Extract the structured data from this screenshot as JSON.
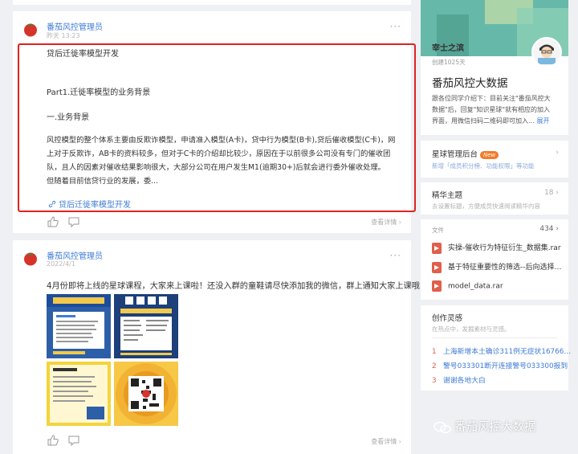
{
  "posts": [
    {
      "author": "番茄风控管理员",
      "time": "昨天 13:23",
      "more": "···",
      "lines": [
        "贷后迁徙率模型开发",
        "Part1.迁徙率模型的业务背景",
        "一.业务背景"
      ],
      "paragraph": [
        "风控模型的整个体系主要由反欺诈模型，申请准入模型(A卡)，贷中行为模型(B卡),贷后催收模型(C卡)，网",
        "上对于反欺诈，AB卡的资料较多，但对于C卡的介绍却比较少，原因在于以前很多公司没有专门的催收团",
        "队，且人的因素对催收结果影响很大，大部分公司在用户发生M1(逾期30+)后就会进行委外催收处理。",
        "但随着目前信贷行业的发展，委..."
      ],
      "link": "贷后迁徙率模型开发",
      "detail": "查看详情 ›"
    },
    {
      "author": "番茄风控管理员",
      "time": "2022/4/1",
      "more": "···",
      "text": "4月份即将上线的星球课程，大家来上课啦！还没入群的童鞋请尽快添加我的微信，群上通知大家上课哦！",
      "detail": "查看详情 ›"
    }
  ],
  "sidebar": {
    "planet_name": "宰士之滨",
    "created": "创建1025天",
    "title": "番茄风控大数据",
    "desc_lines": [
      "跟各位同学介绍下：目前关注\"番茄风控大",
      "数据\"后，回复\"知识星球\"就有相应的加入",
      "界面，用微信扫码二维码即可加入…"
    ],
    "expand": "展开",
    "admin": {
      "title": "星球管理后台",
      "badge": "New",
      "sub": "新增「成员积分榜、功能权限」等功能"
    },
    "featured": {
      "title": "精华主题",
      "count": "18",
      "sub": "去设置标题，方便成员快速阅读精华内容"
    },
    "files": {
      "title": "文件",
      "count": "434",
      "items": [
        "实操-催收行为特征衍生_数据集.rar",
        "基于特征重要性的筛选--后向选择…",
        "model_data.rar"
      ]
    },
    "inspiration": {
      "title": "创作灵感",
      "sub": "在热点中，发掘素材与灵感。"
    },
    "hot": [
      {
        "num": "1",
        "text": "上海新增本土确诊311例无症状16766…"
      },
      {
        "num": "2",
        "text": "警号033301断开连接警号033300报到"
      },
      {
        "num": "3",
        "text": "谢谢各地大白"
      }
    ]
  },
  "watermark": "番茄风控大数据",
  "colors": {
    "accent": "#3f7bd6",
    "highlight_border": "#e0231f",
    "badge": "#f07c2a"
  }
}
